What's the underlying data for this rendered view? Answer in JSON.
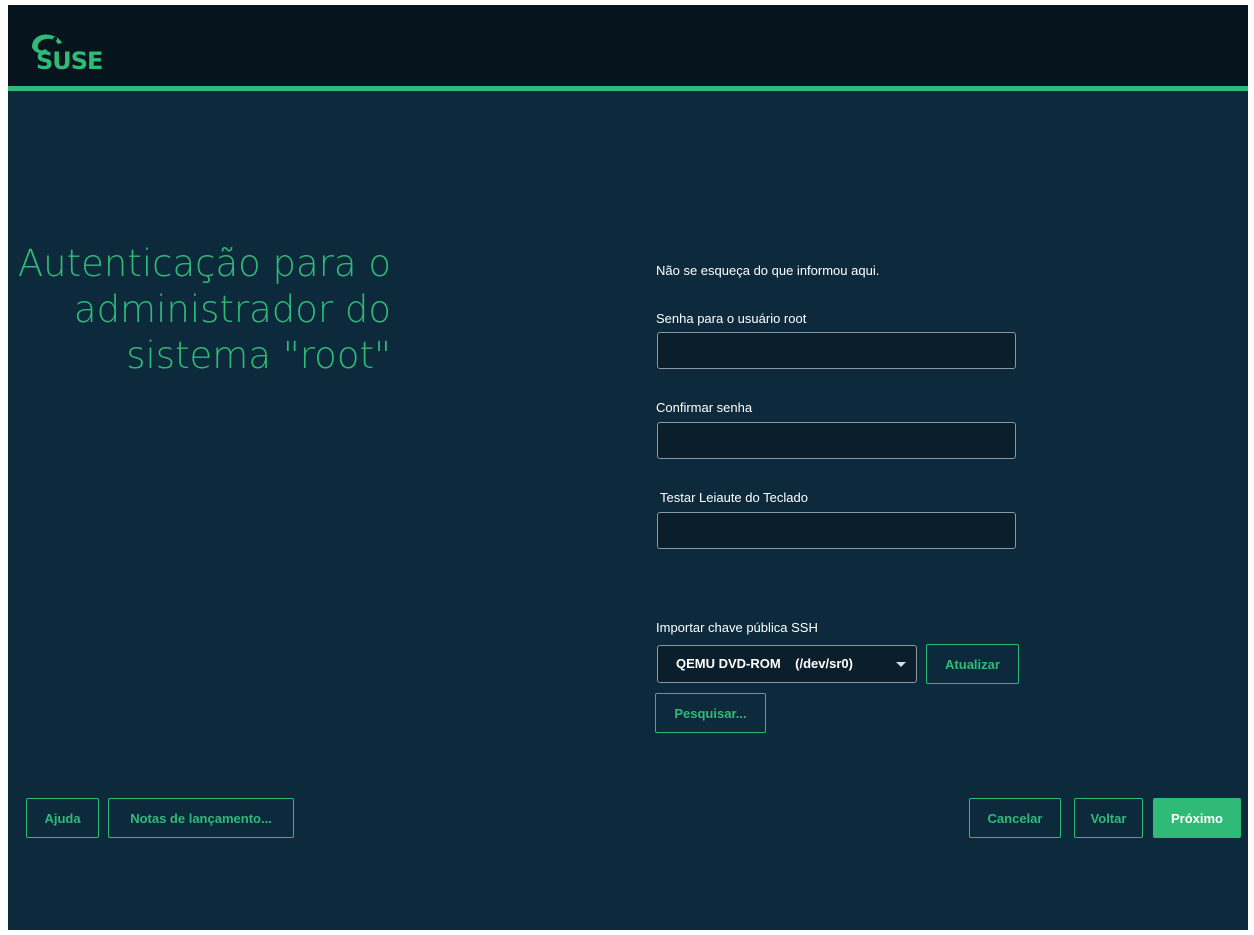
{
  "header": {
    "logo_text": "SUSE",
    "colors": {
      "accent": "#30ba78",
      "bar": "#06141d",
      "bg": "#0c2a3c"
    }
  },
  "title": "Autenticação para o\nadministrador do\nsistema \"root\"",
  "form": {
    "reminder": "Não se esqueça do que informou aqui.",
    "password_label": "Senha para o usuário root",
    "password_value": "",
    "confirm_label": "Confirmar senha",
    "confirm_value": "",
    "keyboard_label": "Testar Leiaute do Teclado",
    "keyboard_value": "",
    "ssh_label": "Importar chave pública SSH",
    "ssh_device": "QEMU DVD-ROM    (/dev/sr0)",
    "refresh_button": "Atualizar",
    "browse_button": "Pesquisar..."
  },
  "footer": {
    "help": "Ajuda",
    "release_notes": "Notas de lançamento...",
    "cancel": "Cancelar",
    "back": "Voltar",
    "next": "Próximo"
  }
}
